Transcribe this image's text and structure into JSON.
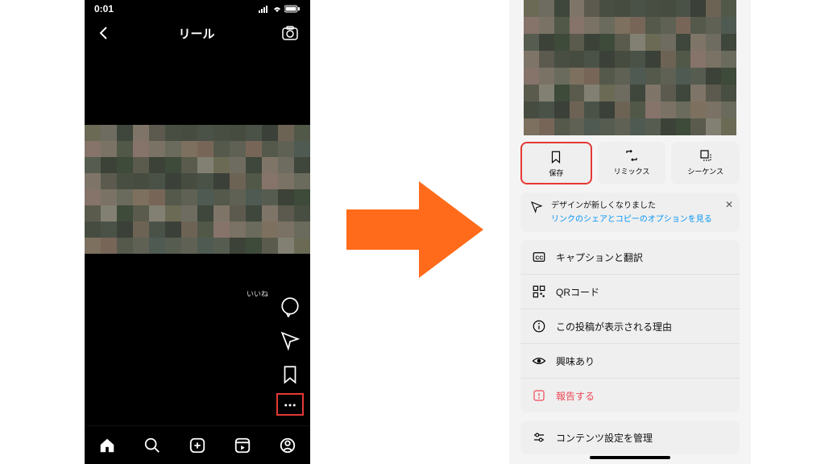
{
  "status": {
    "time": "0:01"
  },
  "header": {
    "title": "リール"
  },
  "likes_label": "いいね",
  "actions": {
    "save": "保存",
    "remix": "リミックス",
    "sequence": "シーケンス"
  },
  "banner": {
    "text": "デザインが新しくなりました",
    "link": "リンクのシェアとコピーのオプションを見る"
  },
  "menu": {
    "caption": "キャプションと翻訳",
    "qr": "QRコード",
    "why": "この投稿が表示される理由",
    "interest": "興味あり",
    "report": "報告する",
    "content": "コンテンツ設定を管理"
  },
  "mosaic_colors": [
    "#6b6a55",
    "#4a5248",
    "#7d705e",
    "#3e4a3a",
    "#5c5a4e",
    "#86736a",
    "#4f5a52",
    "#6e6c60",
    "#3b4038",
    "#776658",
    "#5a5b4d",
    "#484e42",
    "#7a7265",
    "#565c50",
    "#3f463c",
    "#6d6355",
    "#54594b",
    "#828072",
    "#474c40",
    "#6a6b5d",
    "#3c4237",
    "#7e7568",
    "#525848",
    "#5e6153"
  ]
}
